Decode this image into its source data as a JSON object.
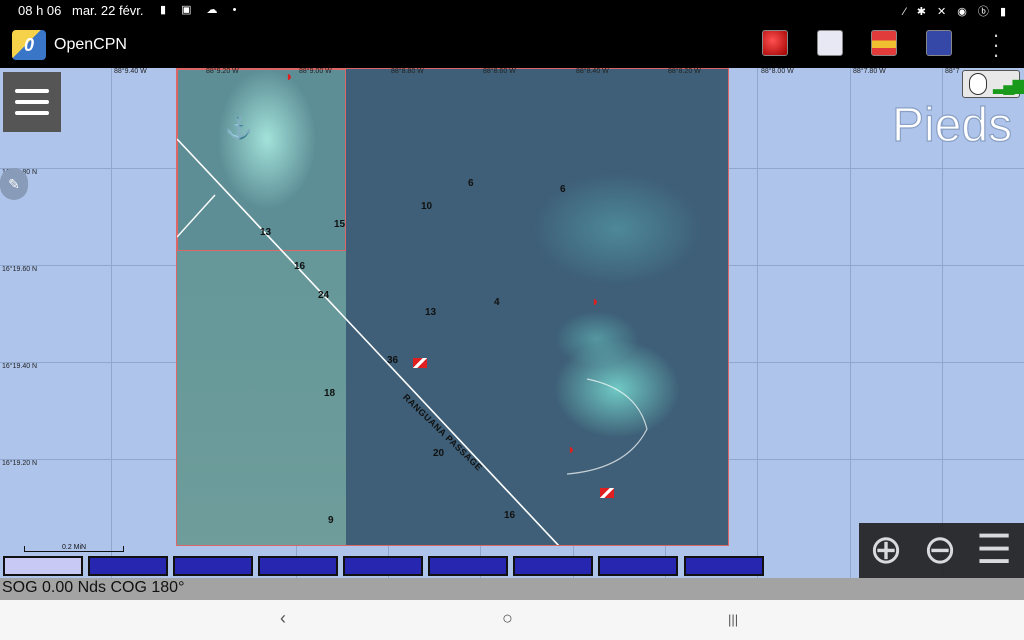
{
  "status_bar": {
    "time": "08 h 06",
    "date": "mar. 22 févr."
  },
  "app": {
    "title": "OpenCPN",
    "logo_glyph": "0"
  },
  "map": {
    "lon_labels": [
      "88°9.40 W",
      "88°9.20 W",
      "88°9.00 W",
      "88°8.80 W",
      "88°8.60 W",
      "88°8.40 W",
      "88°8.20 W",
      "88°8.00 W",
      "88°7.80 W",
      "88°7"
    ],
    "lat_labels": [
      "16°19.80 N",
      "16°19.60 N",
      "16°19.40 N",
      "16°19.20 N"
    ],
    "soundings": [
      "6",
      "6",
      "10",
      "15",
      "13",
      "16",
      "24",
      "4",
      "13",
      "36",
      "18",
      "20",
      "16",
      "9"
    ],
    "passage_label": "RANGUANA PASSAGE",
    "units_label": "Pieds",
    "scale_label": "0.2 MiN"
  },
  "status_line": {
    "text": "SOG 0.00 Nds  COG 180°"
  },
  "navbar": {
    "back": "‹",
    "home": "○",
    "recents": "|||"
  }
}
